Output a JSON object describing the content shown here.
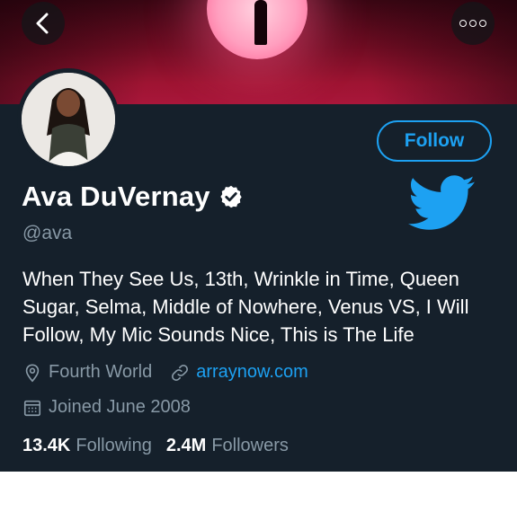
{
  "header": {
    "back_icon": "chevron-left-icon",
    "more_icon": "more-horizontal-icon"
  },
  "profile": {
    "display_name": "Ava DuVernay",
    "verified_icon": "verified-badge-icon",
    "handle": "@ava",
    "follow_label": "Follow",
    "bio": "When They See Us, 13th, Wrinkle in Time, Queen Sugar, Selma, Middle of Nowhere, Venus VS, I Will Follow, My Mic Sounds Nice, This is The Life",
    "location": "Fourth World",
    "website": "arraynow.com",
    "joined": "Joined June 2008",
    "following_count": "13.4K",
    "following_label": "Following",
    "followers_count": "2.4M",
    "followers_label": "Followers"
  },
  "colors": {
    "background": "#15202b",
    "accent": "#1da1f2",
    "secondary_text": "#8899a6",
    "primary_text": "#ffffff"
  }
}
